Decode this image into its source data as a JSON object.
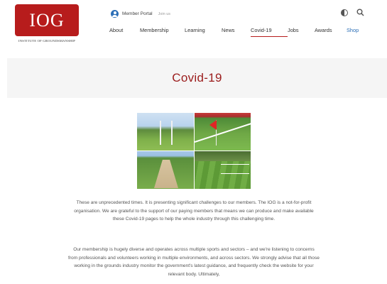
{
  "logo": {
    "text": "IOG",
    "subtitle": "INSTITUTE OF GROUNDSMANSHIP"
  },
  "member": {
    "label": "Member Portal",
    "join": "Join us"
  },
  "nav": [
    {
      "label": "About",
      "width": 43
    },
    {
      "label": "Membership",
      "width": 63
    },
    {
      "label": "Learning",
      "width": 52
    },
    {
      "label": "News",
      "width": 41
    },
    {
      "label": "Covid-19",
      "width": 52
    },
    {
      "label": "Jobs",
      "width": 38
    },
    {
      "label": "Awards",
      "width": 45
    },
    {
      "label": "Shop",
      "width": 30
    }
  ],
  "page": {
    "title": "Covid-19"
  },
  "content": {
    "p1": "These are unprecedented times. It is presenting significant challenges to our members. The IOG is a not-for-profit organisation. We are grateful to the support of our paying members that means we can produce and make available these Covid-19 pages to help the whole industry through this challenging time.",
    "p2": "Our membership is hugely diverse and operates across multiple sports and sectors – and we're listening to concerns from professionals and volunteers working in multiple environments, and across sectors. We strongly advise that all those working in the grounds industry monitor the government's latest guidance, and frequently check the website for your relevant body. Ultimately,"
  },
  "colors": {
    "brand": "#b71c1c",
    "title": "#9b1c1c",
    "link": "#2c6fb7"
  },
  "icons": {
    "contrast": "contrast-icon",
    "search": "search-icon",
    "user": "user-icon"
  }
}
